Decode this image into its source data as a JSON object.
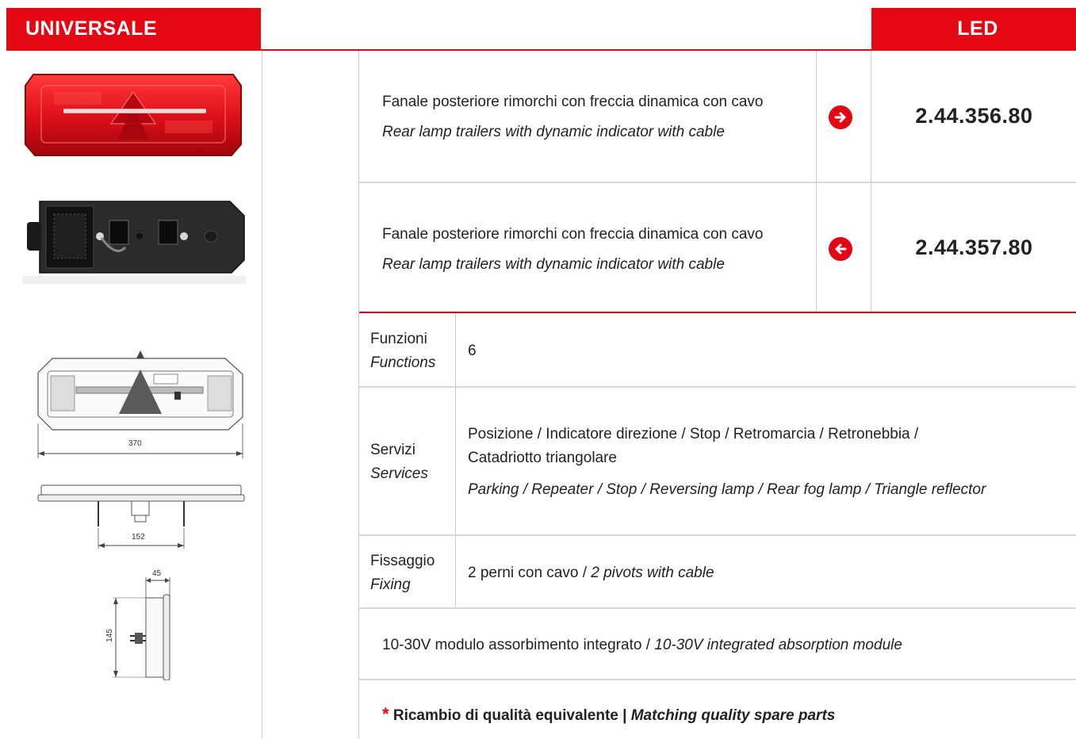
{
  "header": {
    "left_label": "UNIVERSALE",
    "right_label": "LED"
  },
  "products": [
    {
      "desc_it": "Fanale posteriore rimorchi con freccia dinamica con cavo",
      "desc_en": "Rear lamp trailers with dynamic indicator with cable",
      "direction_icon": "arrow-right-icon",
      "code": "2.44.356.80"
    },
    {
      "desc_it": "Fanale posteriore rimorchi con freccia dinamica con cavo",
      "desc_en": "Rear lamp trailers with dynamic indicator with cable",
      "direction_icon": "arrow-left-icon",
      "code": "2.44.357.80"
    }
  ],
  "specs": {
    "functions": {
      "label_it": "Funzioni",
      "label_en": "Functions",
      "value": "6"
    },
    "services": {
      "label_it": "Servizi",
      "label_en": "Services",
      "value_it_line1": "Posizione / Indicatore direzione / Stop / Retromarcia / Retronebbia /",
      "value_it_line2": "Catadriotto triangolare",
      "value_en": "Parking / Repeater / Stop / Reversing lamp / Rear fog lamp / Triangle reflector"
    },
    "fixing": {
      "label_it": "Fissaggio",
      "label_en": "Fixing",
      "value_it": "2 perni con cavo /",
      "value_en": "2 pivots with cable"
    }
  },
  "voltage": {
    "it": "10-30V modulo assorbimento integrato /",
    "en": "10-30V integrated absorption module"
  },
  "footer": {
    "asterisk": "*",
    "it": "Ricambio di qualità equivalente |",
    "en": "Matching quality spare parts"
  },
  "drawings": {
    "width_dim": "370",
    "pivot_dim": "152",
    "depth_dim": "45",
    "height_dim": "145"
  },
  "colors": {
    "brand_red": "#e30613",
    "line_gray": "#d8d8d8"
  }
}
